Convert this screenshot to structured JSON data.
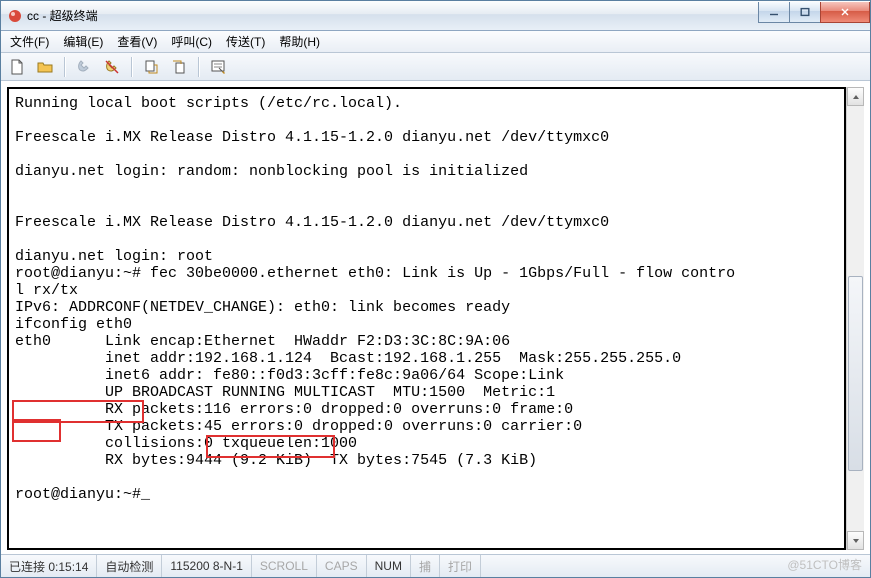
{
  "window": {
    "title": "cc - 超级终端"
  },
  "menu": {
    "file": "文件(F)",
    "edit": "编辑(E)",
    "view": "查看(V)",
    "call": "呼叫(C)",
    "transfer": "传送(T)",
    "help": "帮助(H)"
  },
  "toolbar": {
    "new": "new-doc-icon",
    "open": "open-folder-icon",
    "connect": "phone-connect-icon",
    "disconnect": "phone-disconnect-icon",
    "send": "send-file-icon",
    "receive": "receive-file-icon",
    "properties": "properties-icon"
  },
  "terminal": {
    "text": "Running local boot scripts (/etc/rc.local).\n\nFreescale i.MX Release Distro 4.1.15-1.2.0 dianyu.net /dev/ttymxc0\n\ndianyu.net login: random: nonblocking pool is initialized\n\n\nFreescale i.MX Release Distro 4.1.15-1.2.0 dianyu.net /dev/ttymxc0\n\ndianyu.net login: root\nroot@dianyu:~# fec 30be0000.ethernet eth0: Link is Up - 1Gbps/Full - flow contro\nl rx/tx\nIPv6: ADDRCONF(NETDEV_CHANGE): eth0: link becomes ready\nifconfig eth0\neth0      Link encap:Ethernet  HWaddr F2:D3:3C:8C:9A:06\n          inet addr:192.168.1.124  Bcast:192.168.1.255  Mask:255.255.255.0\n          inet6 addr: fe80::f0d3:3cff:fe8c:9a06/64 Scope:Link\n          UP BROADCAST RUNNING MULTICAST  MTU:1500  Metric:1\n          RX packets:116 errors:0 dropped:0 overruns:0 frame:0\n          TX packets:45 errors:0 dropped:0 overruns:0 carrier:0\n          collisions:0 txqueuelen:1000\n          RX bytes:9444 (9.2 KiB)  TX bytes:7545 (7.3 KiB)\n\nroot@dianyu:~#_"
  },
  "highlights": {
    "cmd": "ifconfig eth0",
    "iface": "eth0",
    "ip": "192.168.1.124"
  },
  "status": {
    "conn": "已连接 0:15:14",
    "detect": "自动检测",
    "port": "115200 8-N-1",
    "scroll": "SCROLL",
    "caps": "CAPS",
    "num": "NUM",
    "capture": "捕",
    "print": "打印"
  },
  "watermark": "@51CTO博客"
}
